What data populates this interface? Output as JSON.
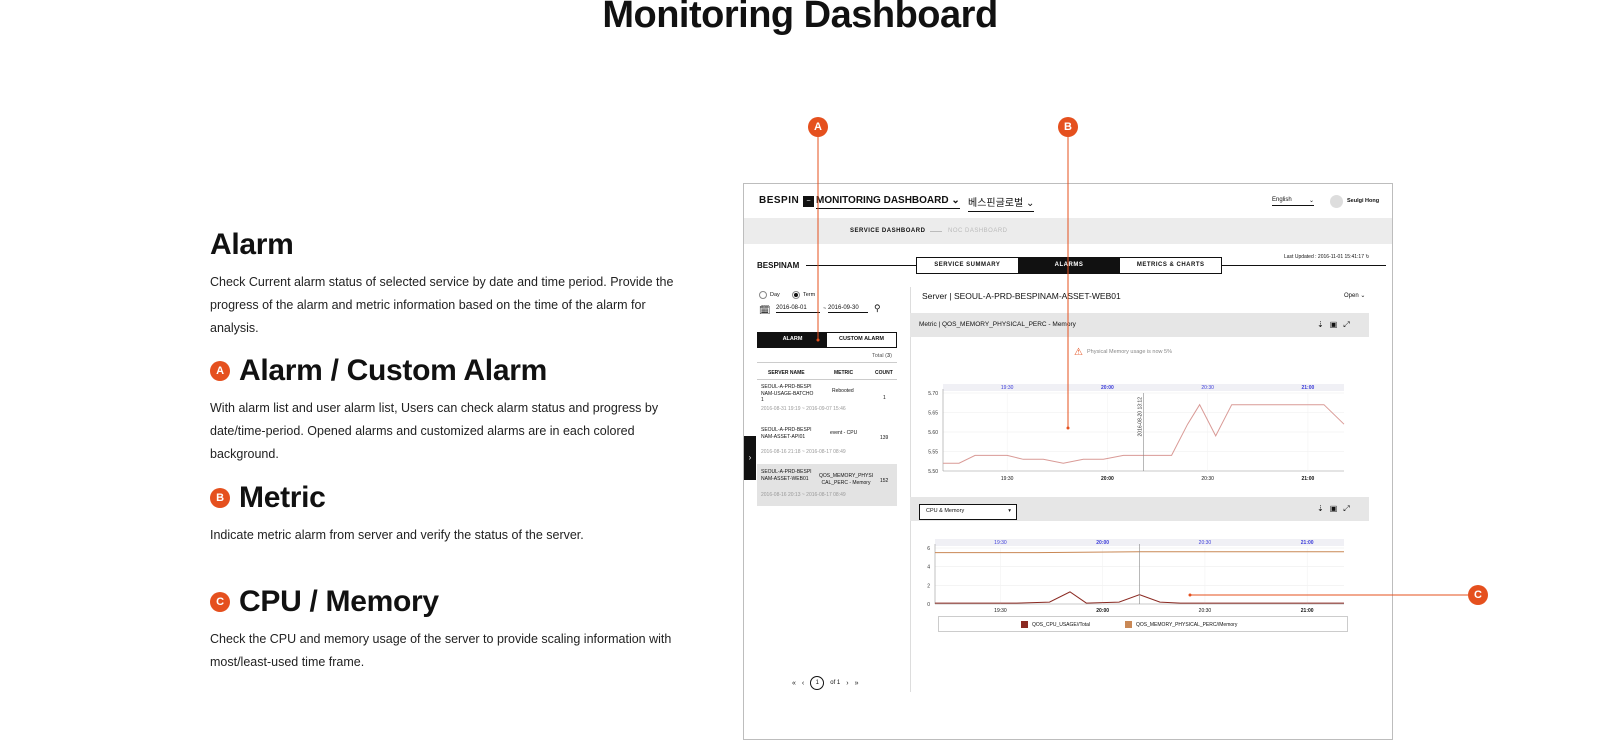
{
  "page_title": "Monitoring Dashboard",
  "sections": [
    {
      "badge": "",
      "title": "Alarm",
      "text": "Check Current alarm status of selected service by date and time period. Provide the progress of the alarm and metric information based on the time of the alarm for analysis."
    },
    {
      "badge": "A",
      "title": "Alarm / Custom Alarm",
      "text": "With alarm list and user alarm list, Users can check alarm status and progress by date/time-period. Opened alarms and customized alarms are in each colored background."
    },
    {
      "badge": "B",
      "title": "Metric",
      "text": "Indicate metric alarm from server and verify the status of the server."
    },
    {
      "badge": "C",
      "title": "CPU / Memory",
      "text": "Check the CPU and memory usage of the server to provide scaling information with most/least-used time frame."
    }
  ],
  "callouts": [
    "A",
    "B",
    "C"
  ],
  "accent_color": "#e5501e",
  "mock": {
    "brand": "BESPIN",
    "logo_glyph": "~",
    "dashboard_menu": "MONITORING DASHBOARD ⌄",
    "company_menu": "베스핀글로벌 ⌄",
    "language": "English",
    "user_name": "Seulgi Hong",
    "subnav": [
      "SERVICE DASHBOARD",
      "NOC DASHBOARD"
    ],
    "service_name": "BESPINAM",
    "tabs": [
      "SERVICE SUMMARY",
      "ALARMS",
      "METRICS & CHARTS"
    ],
    "active_tab": "ALARMS",
    "last_updated": "Last Updated : 2016-11-01 15:41:17",
    "period_options": [
      "Day",
      "Term"
    ],
    "date_from": "2016-08-01",
    "date_sep": "~",
    "date_to": "2016-09-30",
    "alarm_tabs": [
      "ALARM",
      "CUSTOM ALARM"
    ],
    "total_label": "Total",
    "total_value": "3",
    "table_headers": [
      "SERVER NAME",
      "METRIC",
      "COUNT"
    ],
    "rows": [
      {
        "server": "SEOUL-A-PRD-BESPI NAM-USAGE-BATCHO 1",
        "metric": "Rebooted",
        "count": "1",
        "period": "2016-08-31 19:19 ~ 2016-09-07 15:46"
      },
      {
        "server": "SEOUL-A-PRD-BESPI NAM-ASSET-API01",
        "metric": "event - CPU",
        "count": "139",
        "period": "2016-08-16 21:18 ~ 2016-08-17 08:49"
      },
      {
        "server": "SEOUL-A-PRD-BESPI NAM-ASSET-WEB01",
        "metric": "QOS_MEMORY_PHYSI CAL_PERC - Memory",
        "count": "152",
        "period": "2016-08-16 20:13 ~ 2016-08-17 08:49"
      }
    ],
    "pager": {
      "first": "«",
      "prev": "‹",
      "current": "1",
      "of": "of 1",
      "next": "›",
      "last": "»"
    },
    "server_title": "Server | SEOUL-A-PRD-BESPINAM-ASSET-WEB01",
    "open_label": "Open ⌄",
    "metric_title": "Metric | QOS_MEMORY_PHYSICAL_PERC - Memory",
    "warning_text": "Physical Memory usage is now 5%",
    "select_value": "CPU & Memory",
    "panel_icons": [
      "⇣",
      "▣",
      "⤢"
    ],
    "side_handle": "›"
  },
  "chart_data": [
    {
      "type": "line",
      "title": "Metric | QOS_MEMORY_PHYSICAL_PERC - Memory",
      "x_ticks": [
        "19:30",
        "20:00",
        "20:30",
        "21:00"
      ],
      "y_ticks": [
        "5.50",
        "5.55",
        "5.60",
        "5.65",
        "5.70"
      ],
      "ylim": [
        5.5,
        5.7
      ],
      "marker_label": "2016-08-20 13:12",
      "series": [
        {
          "color": "#d99a96",
          "x": [
            0,
            0.04,
            0.08,
            0.16,
            0.2,
            0.25,
            0.3,
            0.35,
            0.4,
            0.45,
            0.5,
            0.57,
            0.61,
            0.64,
            0.68,
            0.72,
            0.77,
            0.8,
            0.86,
            0.95,
            1.0
          ],
          "y": [
            5.52,
            5.52,
            5.54,
            5.54,
            5.53,
            5.53,
            5.52,
            5.53,
            5.53,
            5.54,
            5.54,
            5.54,
            5.62,
            5.67,
            5.59,
            5.67,
            5.67,
            5.67,
            5.67,
            5.67,
            5.62
          ]
        }
      ]
    },
    {
      "type": "line",
      "title": "CPU & Memory",
      "x_ticks": [
        "19:30",
        "20:00",
        "20:30",
        "21:00"
      ],
      "y_ticks": [
        "0",
        "2",
        "4",
        "6"
      ],
      "ylim": [
        0,
        6
      ],
      "series": [
        {
          "name": "QOS_CPU_USAGE//Total",
          "color": "#8b2a22",
          "x": [
            0,
            0.2,
            0.28,
            0.33,
            0.37,
            0.45,
            0.5,
            0.55,
            0.6,
            0.7,
            1.0
          ],
          "y": [
            0.1,
            0.1,
            0.2,
            1.3,
            0.1,
            0.2,
            1.0,
            0.2,
            0.1,
            0.1,
            0.1
          ]
        },
        {
          "name": "QOS_MEMORY_PHYSICAL_PERC//Memory",
          "color": "#c98855",
          "x": [
            0,
            0.25,
            0.5,
            0.6,
            0.75,
            1.0
          ],
          "y": [
            5.5,
            5.5,
            5.6,
            5.6,
            5.6,
            5.6
          ]
        }
      ]
    }
  ]
}
